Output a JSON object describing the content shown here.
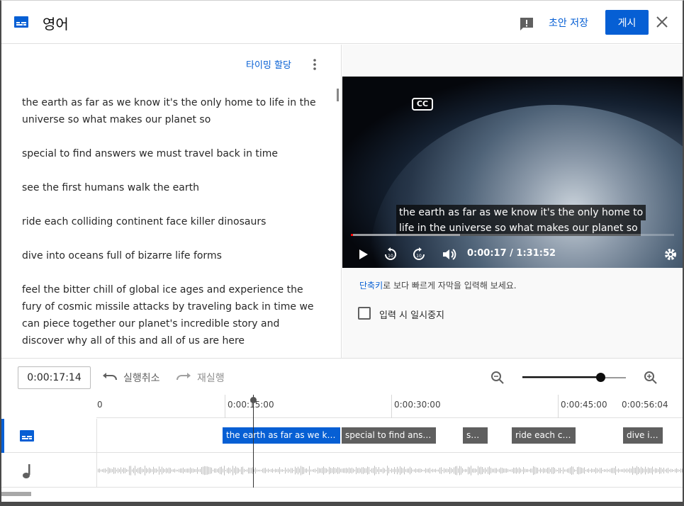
{
  "header": {
    "title": "영어",
    "draft_label": "초안 저장",
    "publish_label": "게시"
  },
  "left": {
    "assign_timing": "타이밍 할당",
    "paragraphs": [
      "the earth as far as we know it's the only home to life in the universe so what makes our planet so",
      "special to find answers we must travel back in time",
      "see the first humans walk the earth",
      "ride each colliding continent face killer dinosaurs",
      "dive into oceans full of bizarre life forms",
      "feel the bitter chill of global ice ages and experience the fury of cosmic missile attacks by traveling back in time we can piece together our planet's incredible story and discover why all of this and all of us are here"
    ]
  },
  "video": {
    "cc_badge": "CC",
    "caption_line1": "the earth as far as we know it's the only home to",
    "caption_line2": "life in the universe so what makes our planet so",
    "time": "0:00:17 / 1:31:52",
    "progress_played": 0.003,
    "progress_loaded": 0.338
  },
  "hint": {
    "link": "단축키",
    "rest": "로 보다 빠르게 자막을 입력해 보세요."
  },
  "pause_label": "입력 시 일시중지",
  "toolbar": {
    "time_value": "0:00:17:14",
    "undo_label": "실행취소",
    "redo_label": "재실행",
    "zoom_level": 0.75
  },
  "timeline": {
    "ruler_labels": [
      "0",
      "0:00:15:00",
      "0:00:30:00",
      "0:00:45:00",
      "0:00:56:04"
    ],
    "cues": [
      "the earth as far as we know it's the only home to life in the universe so what makes our planet so",
      "special to find answers we must travel back in time",
      "see the first humans walk the earth",
      "ride each colliding continent face killer dinosaurs",
      "dive into oceans full of bizarre life forms"
    ],
    "active_cue_index": 0
  },
  "colors": {
    "accent": "#065fd4",
    "cue_inactive": "#5f5f5f"
  },
  "icons": [
    "subtitles-icon",
    "feedback-icon",
    "close-icon",
    "more-vert-icon",
    "play-icon",
    "rewind-10-icon",
    "forward-10-icon",
    "volume-icon",
    "settings-icon",
    "undo-icon",
    "redo-icon",
    "zoom-out-icon",
    "zoom-in-icon",
    "music-note-icon"
  ]
}
